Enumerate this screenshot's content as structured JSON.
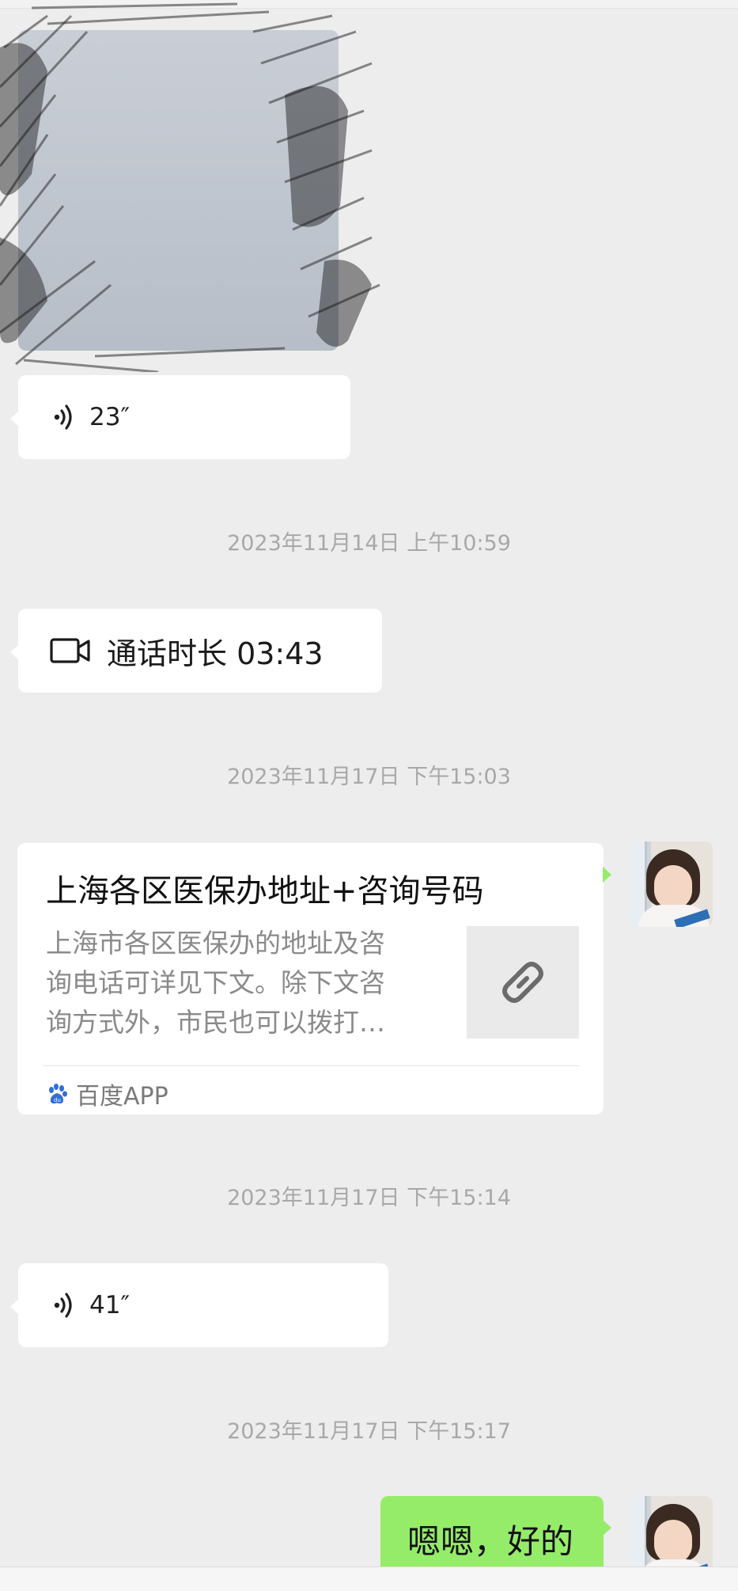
{
  "messages": {
    "voice_1": {
      "duration": "23″"
    },
    "timestamp_1": "2023年11月14日 上午10:59",
    "call": {
      "label": "通话时长 03:43"
    },
    "timestamp_2": "2023年11月17日 下午15:03",
    "link_card": {
      "title": "上海各区医保办地址+咨询号码",
      "desc_lines": [
        "上海市各区医保办的地址及咨",
        "询电话可详见下文。除下文咨",
        "询方式外，市民也可以拨打…"
      ],
      "source": "百度APP"
    },
    "timestamp_3": "2023年11月17日 下午15:14",
    "voice_2": {
      "duration": "41″"
    },
    "timestamp_4": "2023年11月17日 下午15:17",
    "reply": {
      "text": "嗯嗯，好的"
    }
  },
  "colors": {
    "background": "#ededed",
    "bubble_left": "#ffffff",
    "bubble_right": "#95ec69",
    "timestamp_text": "#a8a8a8",
    "link_icon": "#6b6b6b",
    "baidu_icon": "#2f6fd6"
  },
  "icons": {
    "voice": "voice-wave-icon",
    "video_call": "video-camera-icon",
    "link": "link-icon",
    "source": "baidu-paw-icon"
  }
}
